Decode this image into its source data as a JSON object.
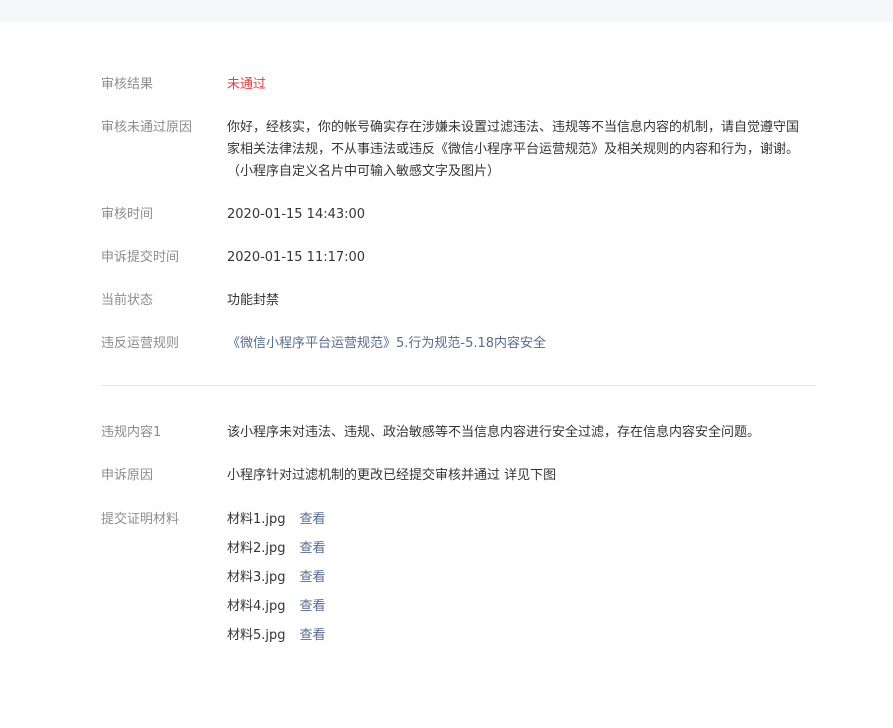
{
  "details": {
    "result_label": "审核结果",
    "result_value": "未通过",
    "reason_label": "审核未通过原因",
    "reason_value": "你好，经核实，你的帐号确实存在涉嫌未设置过滤违法、违规等不当信息内容的机制，请自觉遵守国家相关法律法规，不从事违法或违反《微信小程序平台运营规范》及相关规则的内容和行为，谢谢。（小程序自定义名片中可输入敏感文字及图片）",
    "review_time_label": "审核时间",
    "review_time_value": "2020-01-15 14:43:00",
    "appeal_time_label": "申诉提交时间",
    "appeal_time_value": "2020-01-15 11:17:00",
    "status_label": "当前状态",
    "status_value": "功能封禁",
    "rule_label": "违反运营规则",
    "rule_value": "《微信小程序平台运营规范》5.行为规范-5.18内容安全"
  },
  "appeal": {
    "violation_label": "违规内容1",
    "violation_value": "该小程序未对违法、违规、政治敏感等不当信息内容进行安全过滤，存在信息内容安全问题。",
    "appeal_reason_label": "申诉原因",
    "appeal_reason_value": "小程序针对过滤机制的更改已经提交审核并通过 详见下图",
    "materials_label": "提交证明材料",
    "view_label": "查看",
    "materials": [
      "材料1.jpg",
      "材料2.jpg",
      "材料3.jpg",
      "材料4.jpg",
      "材料5.jpg"
    ]
  },
  "colors": {
    "fail_red": "#e64340",
    "link_blue": "#576b95",
    "label_gray": "#8d8d8d"
  }
}
